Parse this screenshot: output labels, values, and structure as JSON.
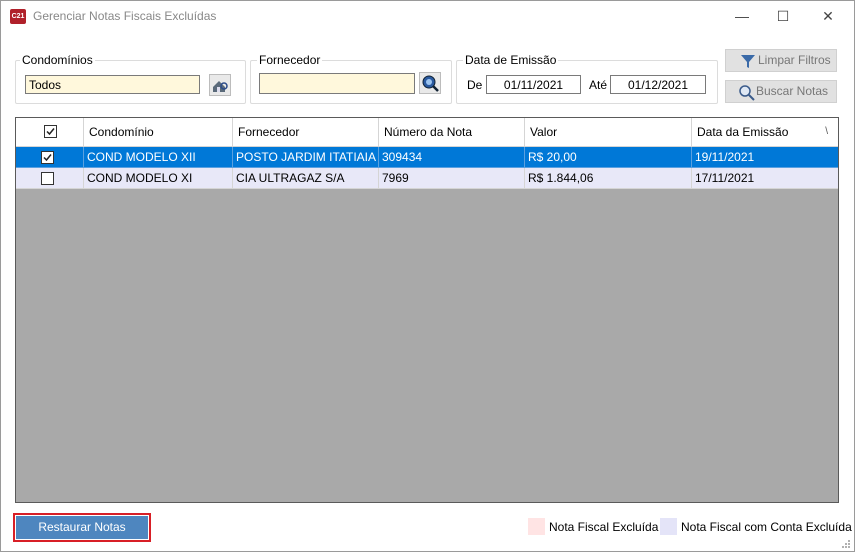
{
  "window": {
    "title": "Gerenciar Notas Fiscais Excluídas",
    "app_icon_text": "C21",
    "minimize": "—",
    "maximize": "☐",
    "close": "✕"
  },
  "filters": {
    "condominios_label": "Condomínios",
    "condominios_value": "Todos",
    "fornecedor_label": "Fornecedor",
    "fornecedor_value": "",
    "data_label": "Data de Emissão",
    "de_label": "De",
    "de_value": "01/11/2021",
    "ate_label": "Até",
    "ate_value": "01/12/2021"
  },
  "buttons": {
    "limpar": "Limpar Filtros",
    "buscar": "Buscar Notas",
    "restaurar": "Restaurar Notas"
  },
  "grid": {
    "columns": [
      "Condomínio",
      "Fornecedor",
      "Número da Nota",
      "Valor",
      "Data da Emissão"
    ],
    "sort_indicator": "\\",
    "rows": [
      {
        "checked": true,
        "condominio": "COND MODELO XII",
        "fornecedor": "POSTO JARDIM ITATIAIA ...",
        "numero": "309434",
        "valor": "R$ 20,00",
        "data": "19/11/2021",
        "selected": true
      },
      {
        "checked": false,
        "condominio": "COND MODELO XI",
        "fornecedor": "CIA ULTRAGAZ S/A",
        "numero": "7969",
        "valor": "R$ 1.844,06",
        "data": "17/11/2021",
        "selected": false
      }
    ]
  },
  "legend": {
    "excluida_label": "Nota Fiscal Excluída",
    "excluida_color": "#ffe4e4",
    "conta_label": "Nota Fiscal com Conta Excluída",
    "conta_color": "#e4e4f8"
  },
  "colors": {
    "selected_row": "#0078d7",
    "row_excluida_conta": "#e8e8f8",
    "restore_button": "#4e86bf",
    "highlight_border": "#d81f26"
  }
}
